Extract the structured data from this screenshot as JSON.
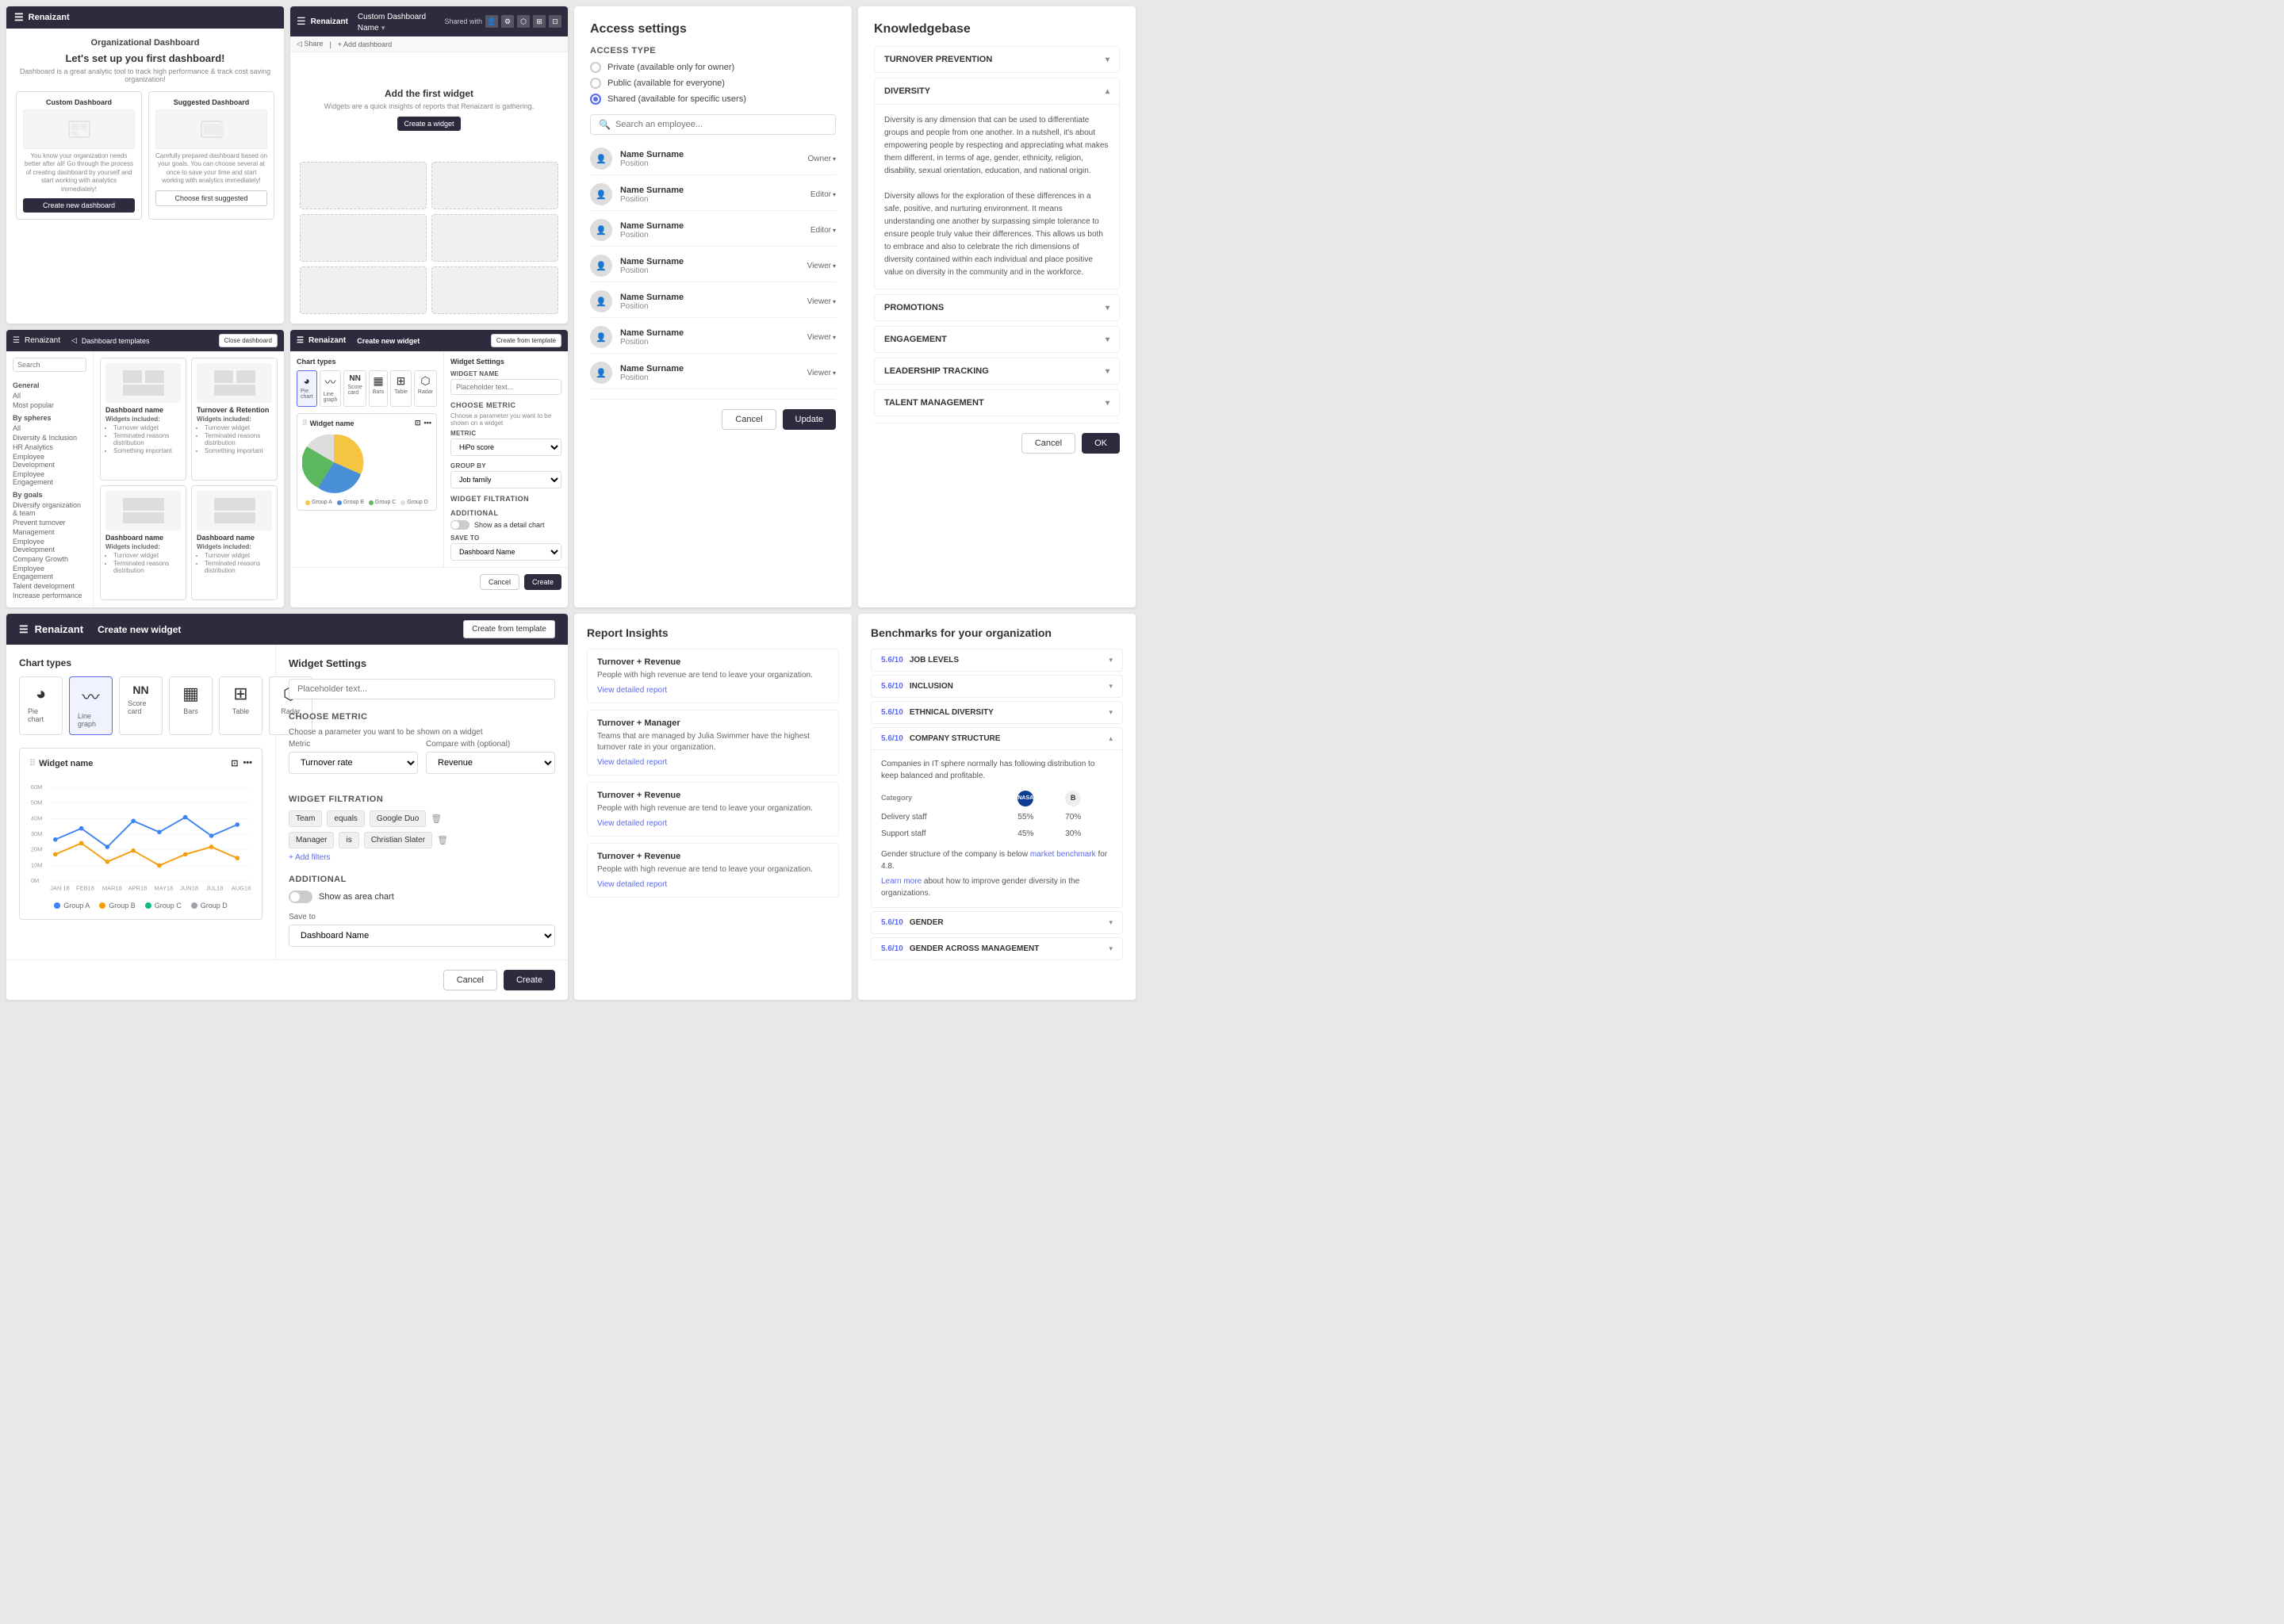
{
  "panels": {
    "org_dashboard": {
      "app_name": "Renaizant",
      "title": "Organizational Dashboard",
      "heading": "Let's set up you first dashboard!",
      "subtitle": "Dashboard is a great analytic tool to track high performance & track cost saving organization!",
      "custom_card": {
        "title": "Custom Dashboard",
        "description": "You know your organization needs better after all! Go through the process of creating dashboard by yourself and start working with analytics immediately!"
      },
      "suggested_card": {
        "title": "Suggested Dashboard",
        "description": "Carefully prepared dashboard based on your goals. You can choose several at once to save your time and start working with analytics immediately!"
      },
      "btn_create": "Create new dashboard",
      "btn_choose": "Choose first suggested"
    },
    "custom_dashboard": {
      "app_name": "Renaizant",
      "title": "Custom Dashboard Name",
      "shared_with": "Shared with",
      "toolbar_items": [
        "Share",
        "Add dashboard"
      ],
      "add_widget_title": "Add the first widget",
      "add_widget_subtitle": "Widgets are a quick insights of reports that Renaizant is gathering.",
      "btn_create_widget": "Create a widget"
    },
    "dashboard_templates": {
      "app_name": "Renaizant",
      "title": "Dashboard templates",
      "btn_close": "Close dashboard",
      "search_placeholder": "Search",
      "sidebar": {
        "sections": [
          {
            "label": "General",
            "items": [
              "All",
              "Most popular"
            ]
          },
          {
            "label": "By spheres",
            "items": [
              "All",
              "Diversity & Inclusion",
              "HR Analytics",
              "Employee Development",
              "Employee Engagement"
            ]
          },
          {
            "label": "By goals",
            "items": [
              "Diversify organization & team",
              "Prevent turnover",
              "Management",
              "Employee Development",
              "Company Growth",
              "Employee Engagement",
              "Talent development",
              "Increase performance"
            ]
          }
        ]
      },
      "templates": [
        {
          "name": "Dashboard name",
          "widgets_label": "Widgets included:",
          "widgets": [
            "Turnover widget",
            "Terminated reasons distribution",
            "Something important"
          ]
        },
        {
          "name": "Turnover & Retention",
          "widgets_label": "Widgets included:",
          "widgets": [
            "Turnover widget",
            "Terminated reasons distribution",
            "Something important"
          ]
        },
        {
          "name": "Dashboard name",
          "widgets_label": "Widgets included:",
          "widgets": [
            "Turnover widget",
            "Terminated reasons distribution"
          ]
        },
        {
          "name": "Dashboard name",
          "widgets_label": "Widgets included:",
          "widgets": [
            "Turnover widget",
            "Terminated reasons distribution"
          ]
        }
      ]
    },
    "create_widget_small": {
      "app_name": "Renaizant",
      "title": "Create new widget",
      "btn_template": "Create from template",
      "chart_types_title": "Chart types",
      "chart_types": [
        {
          "label": "Pie chart",
          "icon": "◕"
        },
        {
          "label": "Line graph",
          "icon": "📈"
        },
        {
          "label": "Score card",
          "icon": "NN"
        },
        {
          "label": "Bars",
          "icon": "▦"
        },
        {
          "label": "Table",
          "icon": "⊞"
        },
        {
          "label": "Radar",
          "icon": "⬡"
        }
      ],
      "widget_name": "Widget name",
      "settings_title": "Widget Settings",
      "widget_name_label": "Widget name",
      "widget_name_placeholder": "Placeholder text...",
      "choose_metric_heading": "CHOOSE METRIC",
      "choose_metric_subtitle": "Choose a parameter you want to be shown on a widget",
      "metric_label": "METRIC",
      "metric_value": "HiPo score",
      "group_by_label": "Group by",
      "group_by_value": "Job family",
      "filtration_heading": "WIDGET FILTRATION",
      "additional_heading": "ADDITIONAL",
      "show_as_area": "Show as a detail chart",
      "save_to_label": "Save to",
      "save_to_value": "Dashboard Name",
      "btn_cancel": "Cancel",
      "btn_create": "Create",
      "pie_groups": [
        "Group A",
        "Group B",
        "Group C",
        "Group D"
      ],
      "pie_colors": [
        "#f5c542",
        "#4a90d9",
        "#5cb85c",
        "#ccc"
      ]
    },
    "access_settings": {
      "title": "Access settings",
      "section_label": "Access Type",
      "options": [
        {
          "label": "Private (available only for owner)",
          "checked": false
        },
        {
          "label": "Public (available for everyone)",
          "checked": false
        },
        {
          "label": "Shared (available for specific users)",
          "checked": true
        }
      ],
      "search_placeholder": "Search an employee...",
      "users": [
        {
          "name": "Name Surname",
          "position": "Position",
          "role": "Owner"
        },
        {
          "name": "Name Surname",
          "position": "Position",
          "role": "Editor"
        },
        {
          "name": "Name Surname",
          "position": "Position",
          "role": "Editor"
        },
        {
          "name": "Name Surname",
          "position": "Position",
          "role": "Viewer"
        },
        {
          "name": "Name Surname",
          "position": "Position",
          "role": "Viewer"
        },
        {
          "name": "Name Surname",
          "position": "Position",
          "role": "Viewer"
        },
        {
          "name": "Name Surname",
          "position": "Position",
          "role": "Viewer"
        }
      ],
      "btn_cancel": "Cancel",
      "btn_update": "Update"
    },
    "knowledgebase": {
      "title": "Knowledgebase",
      "items": [
        {
          "label": "TURNOVER PREVENTION",
          "expanded": false,
          "content": ""
        },
        {
          "label": "DIVERSITY",
          "expanded": true,
          "content": "Diversity is any dimension that can be used to differentiate groups and people from one another. In a nutshell, it's about empowering people by respecting and appreciating what makes them different, in terms of age, gender, ethnicity, religion, disability, sexual orientation, education, and national origin.\n\nDiversity allows for the exploration of these differences in a safe, positive, and nurturing environment. It means understanding one another by surpassing simple tolerance to ensure people truly value their differences. This allows us both to embrace and also to celebrate the rich dimensions of diversity contained within each individual and place positive value on diversity in the community and in the workforce."
        },
        {
          "label": "PROMOTIONS",
          "expanded": false,
          "content": ""
        },
        {
          "label": "ENGAGEMENT",
          "expanded": false,
          "content": ""
        },
        {
          "label": "LEADERSHIP TRACKING",
          "expanded": false,
          "content": ""
        },
        {
          "label": "TALENT MANAGEMENT",
          "expanded": false,
          "content": ""
        }
      ],
      "btn_cancel": "Cancel",
      "btn_ok": "OK"
    },
    "create_widget_large": {
      "app_name": "Renaizant",
      "title": "Create new widget",
      "btn_template": "Create from template",
      "chart_types_title": "Chart types",
      "chart_types": [
        {
          "label": "Pie chart",
          "icon": "◕",
          "active": false
        },
        {
          "label": "Line graph",
          "icon": "〰",
          "active": true
        },
        {
          "label": "Score card",
          "icon": "NN",
          "active": false
        },
        {
          "label": "Bars",
          "icon": "▦",
          "active": false
        },
        {
          "label": "Table",
          "icon": "⊞",
          "active": false
        },
        {
          "label": "Radar",
          "icon": "⬡",
          "active": false
        }
      ],
      "widget_name": "Widget name",
      "settings_title": "Widget Settings",
      "widget_name_placeholder": "Placeholder text...",
      "choose_metric_heading": "CHOOSE METRIC",
      "choose_metric_subtitle": "Choose a parameter you want to be shown on a widget",
      "metric_label": "Metric",
      "metric_value": "Turnover rate",
      "compare_label": "Compare with (optional)",
      "compare_value": "Revenue",
      "filtration_heading": "WIDGET FILTRATION",
      "filters": [
        {
          "key": "Team",
          "op": "equals",
          "val": "Google Duo"
        },
        {
          "key": "Manager",
          "op": "is",
          "val": "Christian Slater"
        }
      ],
      "add_filter_label": "+ Add filters",
      "additional_heading": "ADDITIONAL",
      "show_as_area_label": "Show as area chart",
      "save_to_label": "Save to",
      "save_to_value": "Dashboard Name",
      "btn_cancel": "Cancel",
      "btn_create": "Create",
      "chart": {
        "y_labels": [
          "60M",
          "50M",
          "40M",
          "30M",
          "20M",
          "10M",
          "0M"
        ],
        "x_labels": [
          "JAN 18",
          "FEB18",
          "MAR18",
          "APR18",
          "MAY18",
          "JUN18",
          "JUL18",
          "AUG18"
        ],
        "groups": [
          "Group A",
          "Group B",
          "Group C",
          "Group D"
        ],
        "colors": [
          "#3b82f6",
          "#f59e0b",
          "#10b981",
          "#9ca3af"
        ]
      }
    },
    "report_insights": {
      "title": "Report Insights",
      "cards": [
        {
          "title": "Turnover + Revenue",
          "text": "People with high revenue are tend to leave your organization.",
          "link": "View detailed report"
        },
        {
          "title": "Turnover + Manager",
          "text": "Teams that are managed by Julia Swimmer have the highest turnover rate in your organization.",
          "link": "View detailed report"
        },
        {
          "title": "Turnover + Revenue",
          "text": "People with high revenue are tend to leave your organization.",
          "link": "View detailed report"
        },
        {
          "title": "Turnover + Revenue",
          "text": "People with high revenue are tend to leave your organization.",
          "link": "View detailed report"
        }
      ]
    },
    "benchmarks": {
      "title": "Benchmarks for your organization",
      "items": [
        {
          "score": "5.6/10",
          "label": "JOB LEVELS",
          "expanded": false
        },
        {
          "score": "5.6/10",
          "label": "INCLUSION",
          "expanded": false
        },
        {
          "score": "5.6/10",
          "label": "ETHNICAL DIVERSITY",
          "expanded": false
        },
        {
          "score": "5.6/10",
          "label": "COMPANY STRUCTURE",
          "expanded": true,
          "content": "Companies in IT sphere normally has following distribution to keep balanced and profitable.",
          "table": {
            "headers": [
              "Category",
              "",
              "B"
            ],
            "rows": [
              [
                "Delivery staff",
                "55%",
                "70%"
              ],
              [
                "Support staff",
                "45%",
                "30%"
              ]
            ]
          },
          "footer_text": "Gender structure of the company is below market benchmark for 4.8.",
          "footer_link": "Learn more",
          "footer_rest": " about how to improve gender diversity in the organizations."
        },
        {
          "score": "5.6/10",
          "label": "GENDER",
          "expanded": false
        },
        {
          "score": "5.6/10",
          "label": "GENDER ACROSS MANAGEMENT",
          "expanded": false
        }
      ]
    }
  }
}
